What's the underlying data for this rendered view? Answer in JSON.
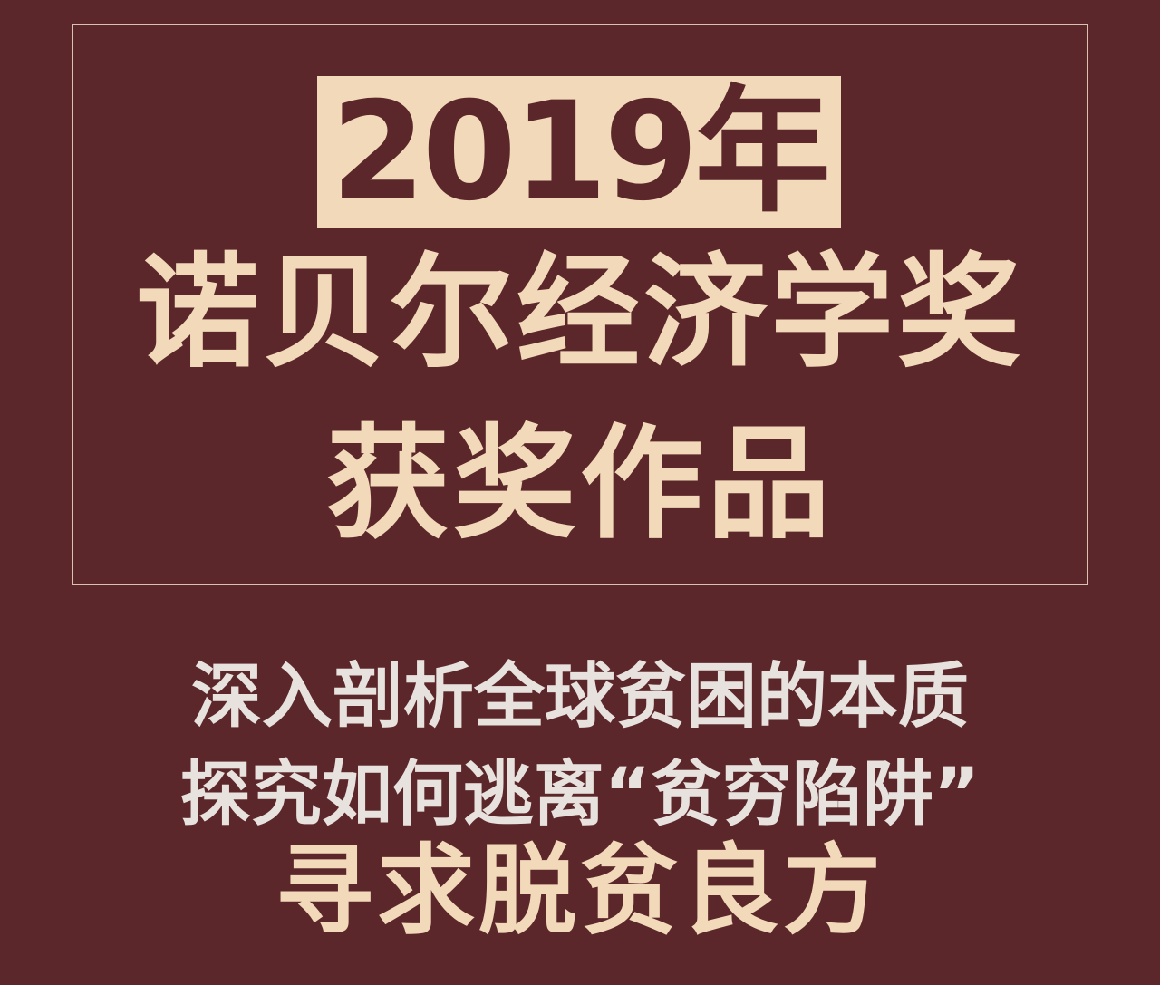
{
  "cover": {
    "year": "2019年",
    "title_line1": "诺贝尔经济学奖",
    "title_line2": "获奖作品",
    "subtitle_line1": "深入剖析全球贫困的本质",
    "subtitle_line2": "探究如何逃离“贫穷陷阱”",
    "tagline": "寻求脱贫良方"
  },
  "colors": {
    "background": "#5c272b",
    "accent": "#f1d9b9",
    "subtitle_text": "#e8e2de",
    "frame_border": "#d9c2b0"
  }
}
